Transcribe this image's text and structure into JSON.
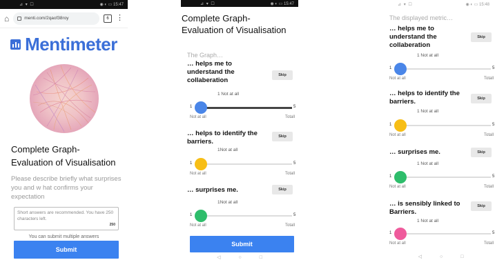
{
  "colors": {
    "blue": "#4a86e8",
    "yellow": "#f7be16",
    "green": "#2ebd6b",
    "pink": "#ef5b9c",
    "accent": "#3b82f0"
  },
  "phone1": {
    "status_left": "⊿ ▾ ☐",
    "status_right": "◉ ◐ ▭ 15:47",
    "url": "menti.com/2qaof38roy",
    "tab_count": "6",
    "logo_text": "Mentimeter",
    "title_line1": "Complete Graph-",
    "title_line2": "Evaluation of Visualisation",
    "description": "Please describe briefly what surprises you and w hat confirms your expectation",
    "textbox_hint": "Short answers are recommended. You have 250 characters left.",
    "char_count": "250",
    "multi_note": "You can submit multiple answers",
    "submit_label": "Submit"
  },
  "phone2": {
    "status_left": "⊿ ▾ ☐",
    "status_right": "◉ ◐ ▭ 15:47",
    "title_line1": "Complete Graph-",
    "title_line2": "Evaluation  of Visualisation",
    "section_label": "The Graph…",
    "questions": [
      {
        "text": "… helps me to understand the collaberation",
        "skip": "Skip",
        "scale_label": "1 Not at all",
        "min": "1",
        "max": "5",
        "foot_left": "Not at all",
        "foot_right": "Totall",
        "value": 1
      },
      {
        "text": "… helps to identify the barriers.",
        "skip": "Skip",
        "scale_label": "1Not at all",
        "min": "1",
        "max": "5",
        "foot_left": "Not at all",
        "foot_right": "Totall",
        "value": 1
      },
      {
        "text": "… surprises me.",
        "skip": "Skip",
        "scale_label": "1Not at all",
        "min": "1",
        "max": "5",
        "foot_left": "Not at all",
        "foot_right": "Totall",
        "value": 1
      }
    ],
    "submit_label": "Submit"
  },
  "phone3": {
    "status_left": "⊿ ▾ ☐",
    "status_right": "◉ ◐ ▭ 15:48",
    "section_label": "The displayed metric…",
    "questions": [
      {
        "text": "… helps me to understand the collaberation",
        "skip": "Skip",
        "scale_label": "1 Not at all",
        "min": "1",
        "max": "5",
        "foot_left": "Not at all",
        "foot_right": "Totall",
        "value": 1
      },
      {
        "text": "… helps to identify the barriers.",
        "skip": "Skip",
        "scale_label": "1 Not at all",
        "min": "1",
        "max": "5",
        "foot_left": "Not at all",
        "foot_right": "Totall",
        "value": 1
      },
      {
        "text": "… surprises me.",
        "skip": "Skip",
        "scale_label": "1 Not at all",
        "min": "1",
        "max": "5",
        "foot_left": "Not at all",
        "foot_right": "Totall",
        "value": 1
      },
      {
        "text": "… is sensibly linked to Barriers.",
        "skip": "Skip",
        "scale_label": "1 Not at all",
        "min": "1",
        "max": "5",
        "foot_left": "Not at all",
        "foot_right": "Totall",
        "value": 1
      }
    ]
  },
  "nav_icons": [
    "◁",
    "○",
    "□"
  ]
}
